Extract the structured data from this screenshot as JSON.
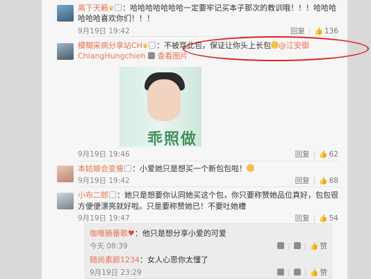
{
  "comments": [
    {
      "name": "离下天籁",
      "text": "：哈哈哈哈哈哈哈一定要牢记买本子那次的教训哦！！！哈哈哈",
      "text2": "哈哈哈喜欢你们！！！",
      "time": "9月19日 19:42",
      "reply": "回复",
      "likes": "136"
    },
    {
      "name": "模糊采病分享站CH",
      "text": "：不被骂此包，保证让你头上长包",
      "mention": "@江安御",
      "sub_name": "ChiangHungchieh",
      "sub_link": "查看图片",
      "photo_text": "乖照做",
      "time": "9月19日 19:46",
      "reply": "回复",
      "likes": "62"
    },
    {
      "name": "本姑娘会变瘦",
      "text": "：小爱她只是想买一个新包包啦！",
      "time": "9月19日 19:42",
      "reply": "回复",
      "likes": "68"
    },
    {
      "name": "小布二郎",
      "text": "：她只是想要你认同她买这个包，你只要称赞她品位真好，包包很",
      "text2": "方便便漂亮就好啦。只是要称赞她已！不要吐她槽",
      "time": "9月19日 19:47",
      "reply": "回复",
      "likes": "54"
    }
  ],
  "replies": [
    {
      "name": "咖喱腩番歌",
      "text": "：他只是想分享小爱的可爱",
      "time": "今天 08:39",
      "like_label": "赞"
    },
    {
      "name": "随尚素颜1234",
      "text": "：女人心思你太懂了",
      "time": "9月19日 23:29",
      "like_label": "赞"
    }
  ],
  "icons": {
    "thumb": "thumbs-up-icon",
    "crown": "vip-crown-icon"
  },
  "colors": {
    "name": "#eb7350",
    "annotation": "#d8201d"
  }
}
